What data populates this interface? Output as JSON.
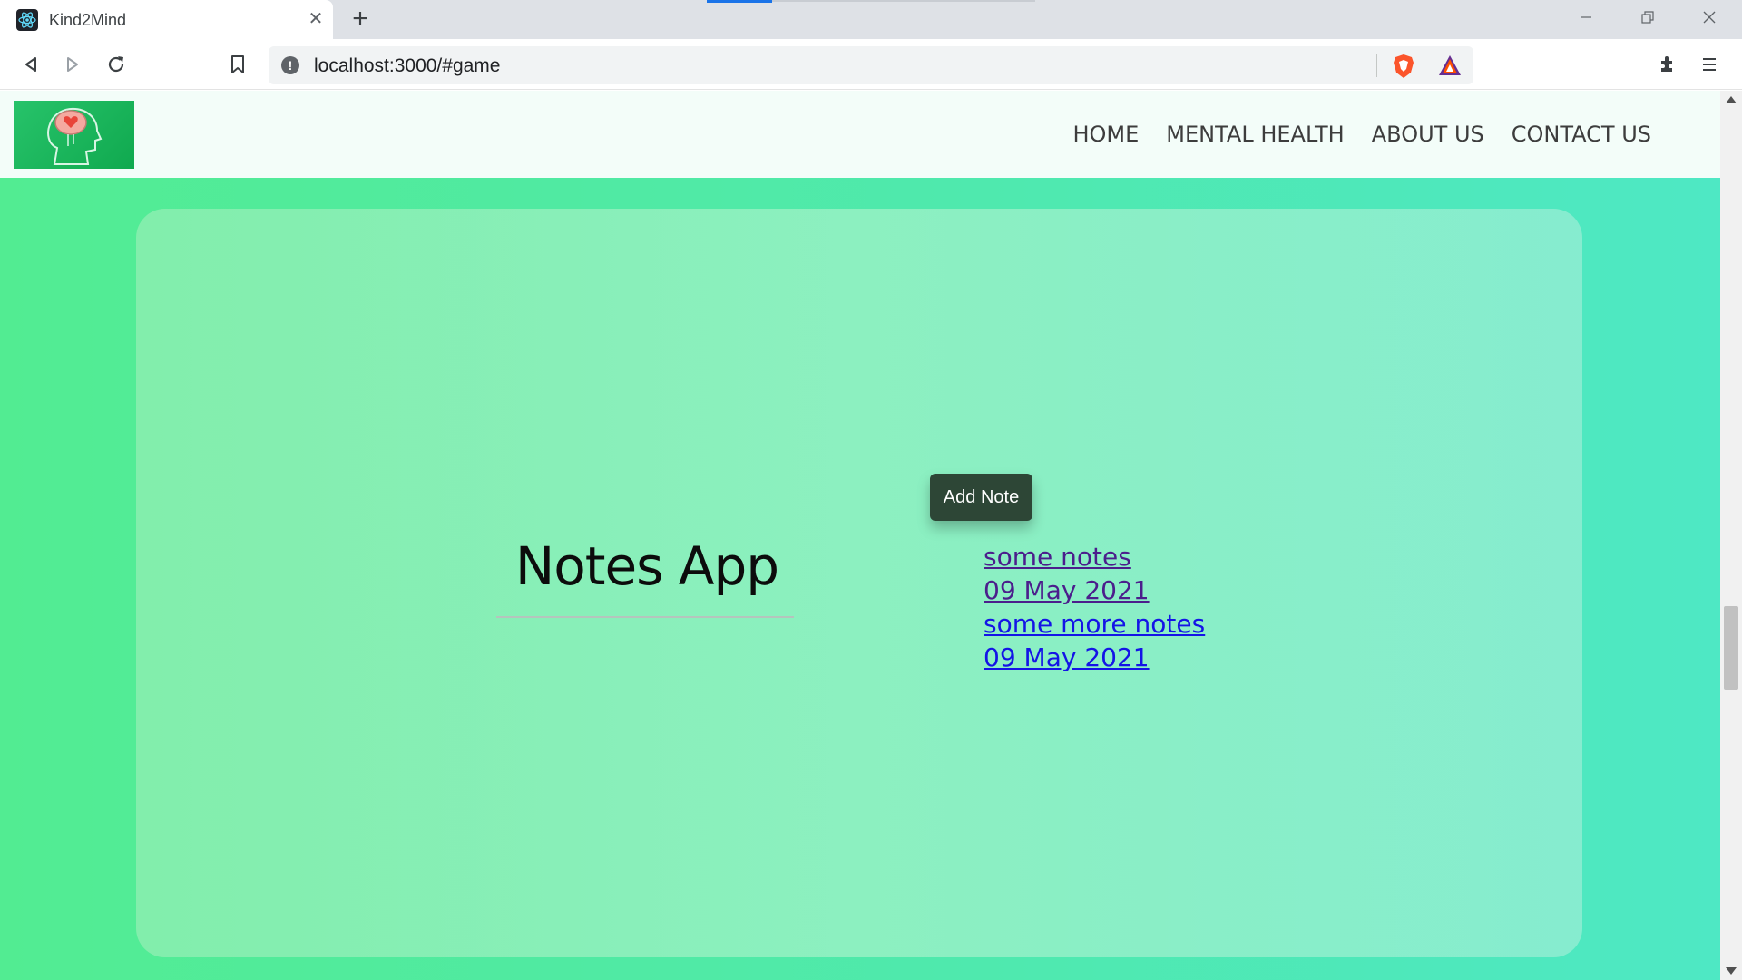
{
  "browser": {
    "tab_title": "Kind2Mind",
    "url": "localhost:3000/#game",
    "tab_close_glyph": "✕",
    "new_tab_glyph": "+",
    "icons": [
      "react-favicon-icon",
      "back-icon",
      "forward-icon",
      "reload-icon",
      "bookmark-icon",
      "info-icon",
      "brave-shields-icon",
      "brave-rewards-icon",
      "extensions-icon",
      "menu-icon"
    ]
  },
  "site": {
    "nav": [
      "HOME",
      "MENTAL HEALTH",
      "ABOUT US",
      "CONTACT US"
    ],
    "title": "Notes App",
    "add_button": "Add Note",
    "notes": [
      {
        "text": "some notes",
        "date": "09 May 2021",
        "visited": true
      },
      {
        "text": "some more notes",
        "date": "09 May 2021",
        "visited": false
      }
    ]
  },
  "colors": {
    "background_left": "#52ec92",
    "background_right": "#4ee8c4",
    "nav_bg": "#f3fdf9",
    "button_bg": "#2d4636",
    "visited_link": "#4b1e8c",
    "link": "#1414e6"
  }
}
